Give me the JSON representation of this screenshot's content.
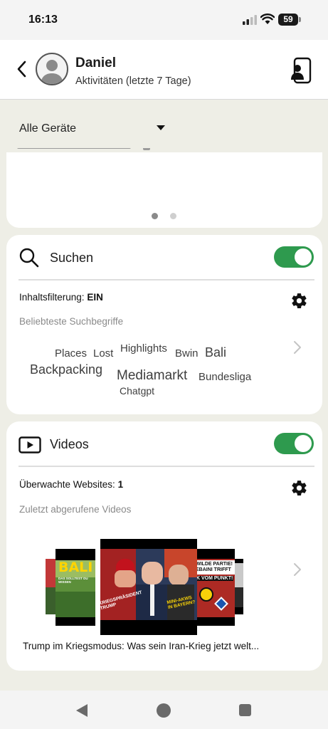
{
  "status_bar": {
    "time": "16:13",
    "battery": "59",
    "icons": [
      "signal-icon",
      "wifi-icon",
      "battery-icon"
    ]
  },
  "header": {
    "name": "Daniel",
    "subtitle": "Aktivitäten (letzte 7 Tage)",
    "icons": [
      "back-icon",
      "avatar",
      "device-icon"
    ]
  },
  "device_filter": {
    "selected": "Alle Geräte"
  },
  "carousel": {
    "page_count": 2,
    "active_page": 1
  },
  "search": {
    "title": "Suchen",
    "enabled": true,
    "filter_label": "Inhaltsfilterung:",
    "filter_value": "EIN",
    "popular_label": "Beliebteste Suchbegriffe",
    "terms": [
      "Places",
      "Lost",
      "Highlights",
      "Bwin",
      "Bali",
      "Backpacking",
      "Mediamarkt",
      "Bundesliga",
      "Chatgpt"
    ]
  },
  "videos": {
    "title": "Videos",
    "enabled": true,
    "watched_label": "Überwachte Websites:",
    "watched_value": "1",
    "recent_label": "Zuletzt abgerufene Videos",
    "thumb_texts": {
      "bali_title": "BALI",
      "bali_sub": "DAS SOLLTEST DU WISSEN",
      "main_left": "KRIEGSPRÄSIDENT TRUMP",
      "main_right": "MINI-AKWS IN BAYERN?",
      "right_top": "WILDE PARTIE!",
      "right_mid": "EBAINI TRIFFT",
      "right_bot": "K VOM PUNKT!"
    },
    "caption": "Trump im Kriegsmodus: Was sein Iran-Krieg jetzt welt..."
  },
  "colors": {
    "accent_green": "#2e9a4e",
    "background": "#eeeee6"
  }
}
